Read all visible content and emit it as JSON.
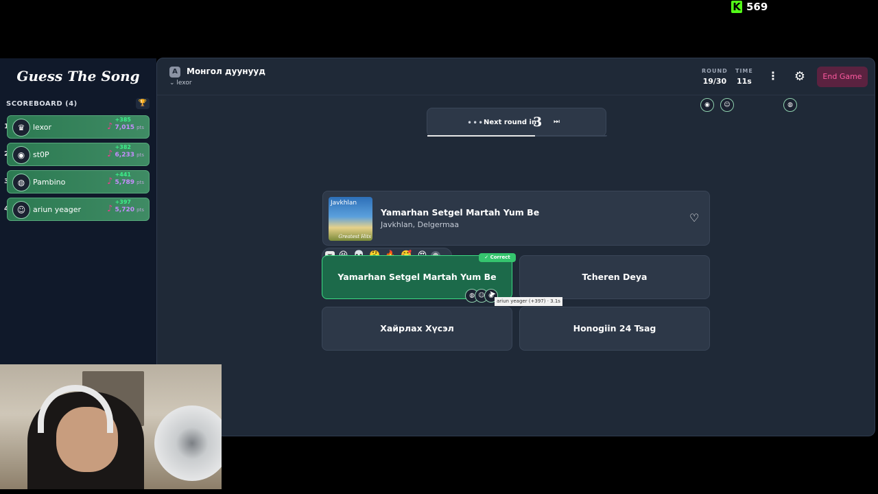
{
  "overlay": {
    "kick_logo": "K",
    "viewer_count": "569"
  },
  "sidebar": {
    "title": "Guess The Song",
    "scoreboard_label": "SCOREBOARD (4)",
    "trophy_icon": "trophy-icon",
    "players": [
      {
        "rank": "1",
        "avatar": "♛",
        "name": "lexor",
        "gain": "+385",
        "points": "7,015",
        "pts_unit": "pts"
      },
      {
        "rank": "2",
        "avatar": "◉",
        "name": "st0P",
        "gain": "+382",
        "points": "6,233",
        "pts_unit": "pts"
      },
      {
        "rank": "3",
        "avatar": "◍",
        "name": "Pambino",
        "gain": "+441",
        "points": "5,789",
        "pts_unit": "pts"
      },
      {
        "rank": "4",
        "avatar": "☺",
        "name": "ariun yeager",
        "gain": "+397",
        "points": "5,720",
        "pts_unit": "pts"
      }
    ]
  },
  "header": {
    "category_icon": "A",
    "category": "Монгол дуунууд",
    "host": "lexor",
    "round_label": "ROUND",
    "round_value": "19/30",
    "time_label": "TIME",
    "time_value": "11s",
    "more_icon": "⋮",
    "gear_icon": "⚙",
    "end_game_label": "End Game"
  },
  "next_round": {
    "dots": "•••",
    "text": "Next round in",
    "count": "3",
    "skip_icon": "⏭",
    "progress": 0.6
  },
  "song": {
    "cover_top": "Javkhlan",
    "cover_bottom": "Greatest Hits",
    "title": "Yamarhan Setgel Martah Yum Be",
    "artist": "Javkhlan, Delgermaa",
    "heart_icon": "♡"
  },
  "reactions": [
    "😆",
    "💀",
    "🤔",
    "🔥",
    "🥰",
    "😍"
  ],
  "correct_badge": "✓ Correct",
  "answers": [
    {
      "label": "Yamarhan Setgel Martah Yum Be",
      "correct": true
    },
    {
      "label": "Tcheren Deya",
      "correct": false
    },
    {
      "label": "Хайрлах Хүсэл",
      "correct": false
    },
    {
      "label": "Honogiin 24 Tsag",
      "correct": false
    }
  ],
  "tooltip": "ariun yeager (+397) · 3.1s",
  "colors": {
    "accent_green": "#3ddc84",
    "end_game": "#ff5aa0",
    "points_purple": "#c78dff",
    "panel_bg": "#1f2937"
  }
}
